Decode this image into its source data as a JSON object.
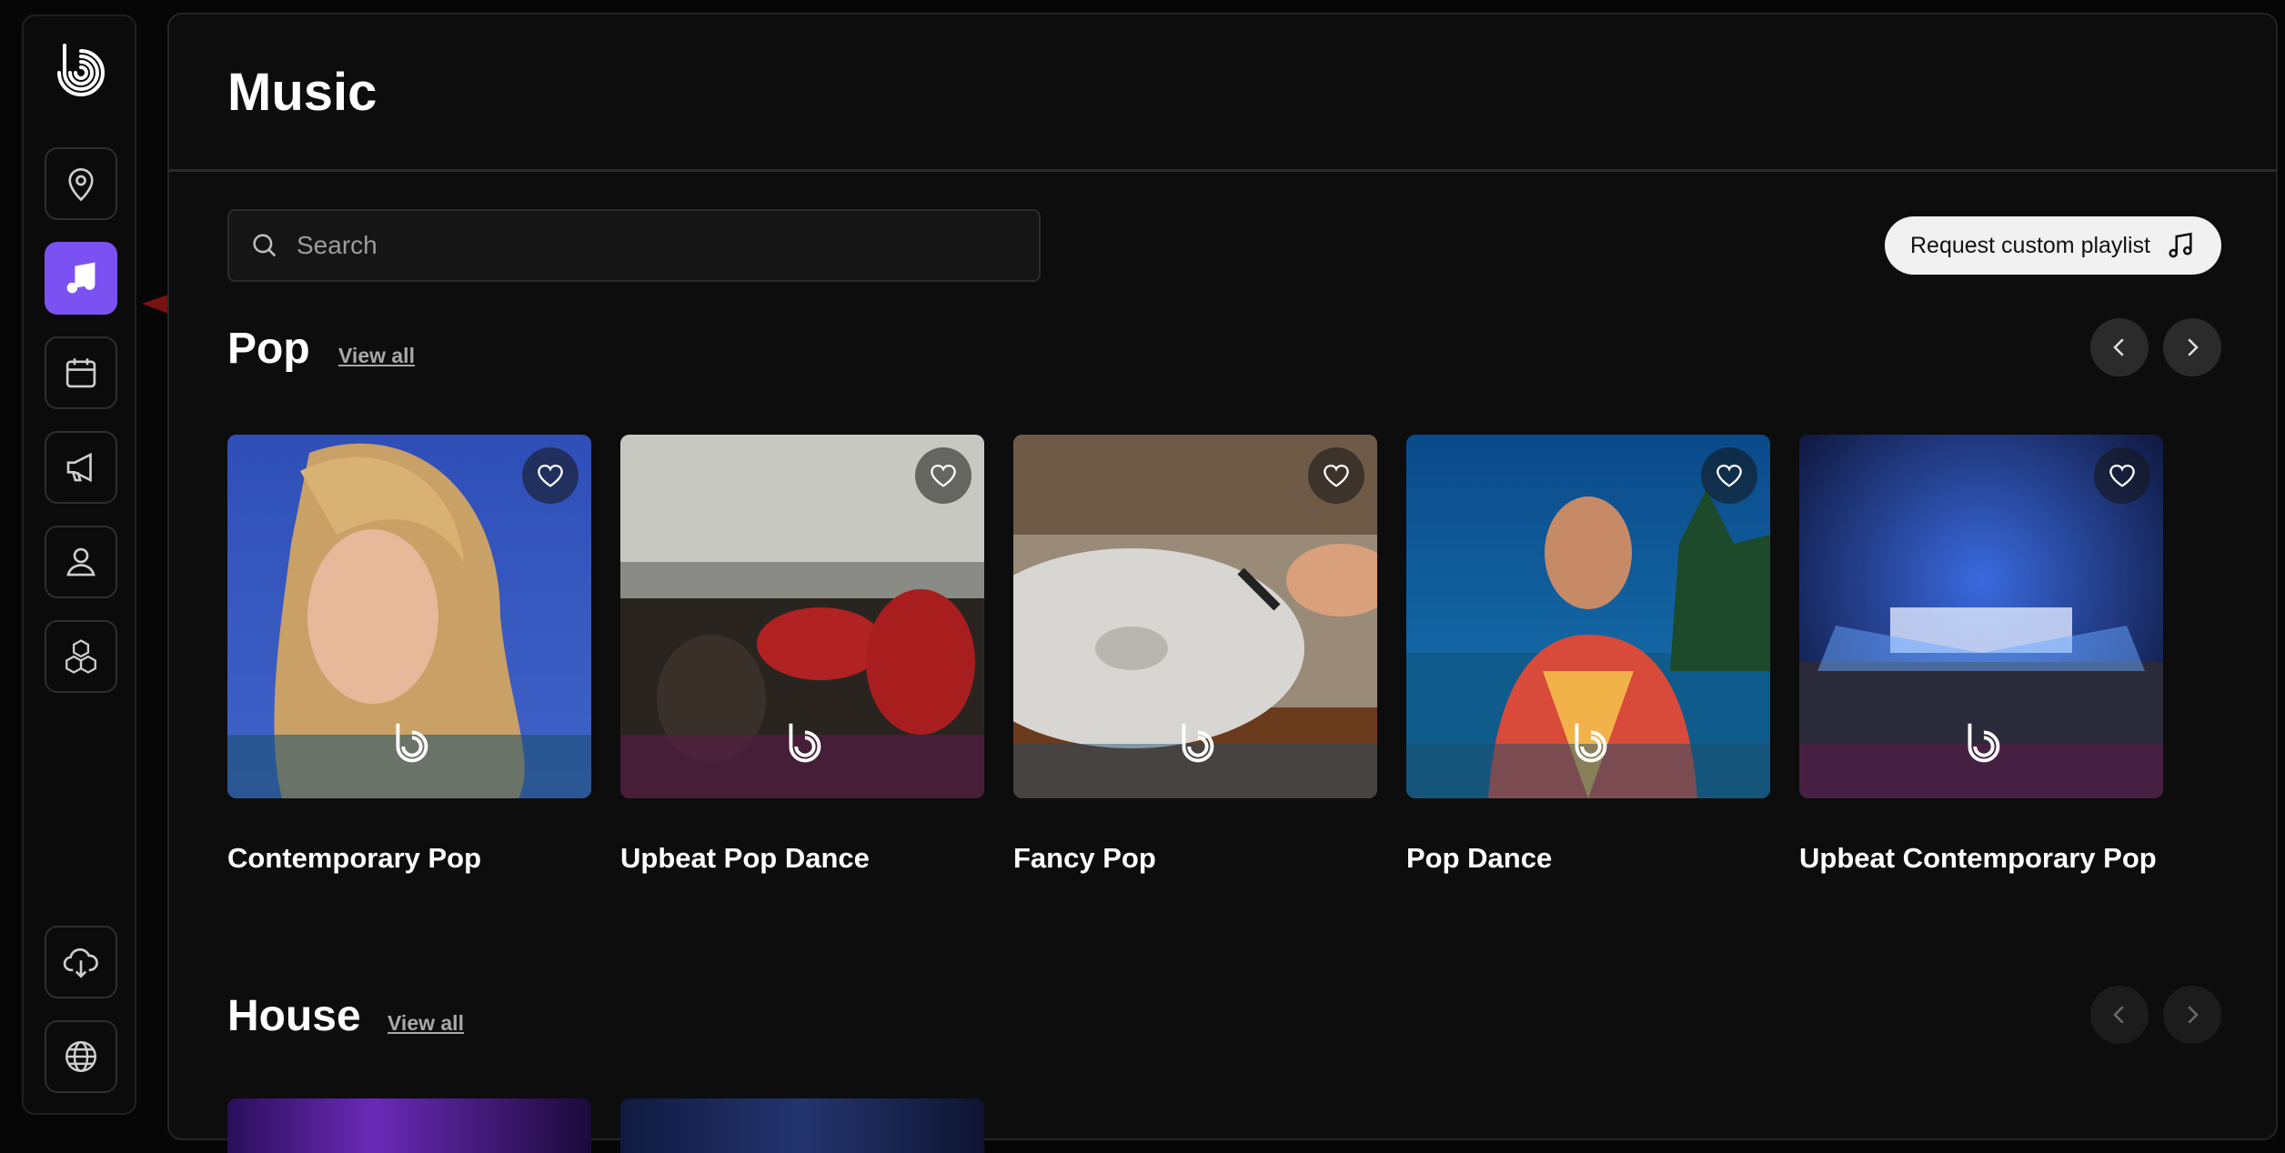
{
  "page": {
    "title": "Music"
  },
  "search": {
    "placeholder": "Search"
  },
  "request_button": {
    "label": "Request custom playlist"
  },
  "sidebar": {
    "items": [
      {
        "id": "locations",
        "icon": "map-pin-icon"
      },
      {
        "id": "music",
        "icon": "music-note-icon",
        "active": true
      },
      {
        "id": "calendar",
        "icon": "calendar-icon"
      },
      {
        "id": "announcements",
        "icon": "megaphone-icon"
      },
      {
        "id": "profile",
        "icon": "user-icon"
      },
      {
        "id": "integrations",
        "icon": "cubes-icon"
      },
      {
        "id": "download",
        "icon": "cloud-download-icon"
      },
      {
        "id": "language",
        "icon": "globe-icon"
      }
    ]
  },
  "sections": [
    {
      "title": "Pop",
      "view_all": "View all",
      "playlists": [
        {
          "name": "Contemporary Pop"
        },
        {
          "name": "Upbeat Pop Dance"
        },
        {
          "name": "Fancy Pop"
        },
        {
          "name": "Pop Dance"
        },
        {
          "name": "Upbeat Contemporary Pop"
        }
      ]
    },
    {
      "title": "House",
      "view_all": "View all"
    }
  ],
  "colors": {
    "accent": "#7b52f1",
    "background": "#0d0d0d",
    "annotation_arrow": "#7a1212"
  }
}
